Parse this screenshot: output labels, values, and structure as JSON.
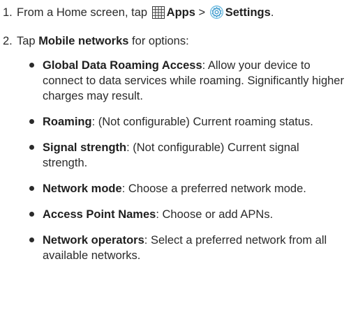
{
  "steps": [
    {
      "number": "1.",
      "pre": "From a Home screen, tap ",
      "apps_label": "Apps",
      "separator": " > ",
      "settings_label": "Settings",
      "post": ".",
      "apps_icon": "apps-grid-icon",
      "settings_icon": "settings-gear-icon"
    },
    {
      "number": "2.",
      "pre": "Tap ",
      "bold": "Mobile networks",
      "post": " for options:"
    }
  ],
  "options": [
    {
      "term": "Global Data Roaming Access",
      "desc": ": Allow your device to connect to data services while roaming. Significantly higher charges may result."
    },
    {
      "term": "Roaming",
      "desc": ": (Not configurable) Current roaming status."
    },
    {
      "term": "Signal strength",
      "desc": ": (Not configurable) Current signal strength."
    },
    {
      "term": "Network mode",
      "desc": ": Choose a preferred network mode."
    },
    {
      "term": "Access Point Names",
      "desc": ": Choose or add APNs."
    },
    {
      "term": "Network operators",
      "desc": ": Select a preferred network from all available networks."
    }
  ]
}
